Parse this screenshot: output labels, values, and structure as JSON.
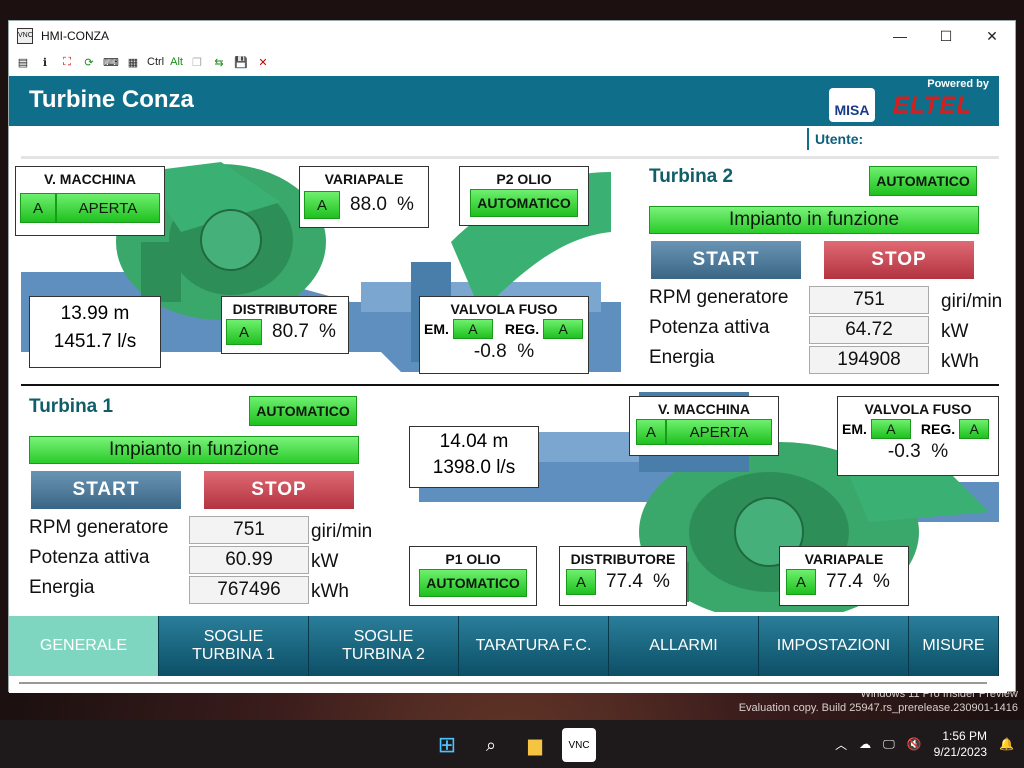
{
  "window": {
    "title": "HMI-CONZA",
    "app_icon": "VNC",
    "controls": [
      "—",
      "☐",
      "✕"
    ]
  },
  "toolbar": {
    "ctrl_label": "Ctrl",
    "alt_label": "Alt"
  },
  "header": {
    "title": "Turbine Conza",
    "powered_by": "Powered by",
    "logo_misa": "MISA",
    "logo_eltel": "ELTEL",
    "user_label": "Utente:"
  },
  "t2": {
    "v_macchina": {
      "title": "V. MACCHINA",
      "mode": "A",
      "state": "APERTA"
    },
    "variapale": {
      "title": "VARIAPALE",
      "mode": "A",
      "value": "88.0",
      "unit": "%"
    },
    "olio": {
      "title": "P2 OLIO",
      "state": "AUTOMATICO"
    },
    "level": {
      "head": "13.99",
      "head_unit": "m",
      "flow": "1451.7",
      "flow_unit": "l/s"
    },
    "distributore": {
      "title": "DISTRIBUTORE",
      "mode": "A",
      "value": "80.7",
      "unit": "%"
    },
    "valvola": {
      "title": "VALVOLA FUSO",
      "em_label": "EM.",
      "em_mode": "A",
      "reg_label": "REG.",
      "reg_mode": "A",
      "value": "-0.8",
      "unit": "%"
    },
    "panel": {
      "title": "Turbina 2",
      "automatico": "AUTOMATICO",
      "status": "Impianto in funzione",
      "start": "START",
      "stop": "STOP",
      "rows": [
        {
          "label": "RPM generatore",
          "value": "751",
          "unit": "giri/min"
        },
        {
          "label": "Potenza attiva",
          "value": "64.72",
          "unit": "kW"
        },
        {
          "label": "Energia",
          "value": "194908",
          "unit": "kWh"
        }
      ]
    }
  },
  "t1": {
    "panel": {
      "title": "Turbina 1",
      "automatico": "AUTOMATICO",
      "status": "Impianto in funzione",
      "start": "START",
      "stop": "STOP",
      "rows": [
        {
          "label": "RPM generatore",
          "value": "751",
          "unit": "giri/min"
        },
        {
          "label": "Potenza attiva",
          "value": "60.99",
          "unit": "kW"
        },
        {
          "label": "Energia",
          "value": "767496",
          "unit": "kWh"
        }
      ]
    },
    "level": {
      "head": "14.04",
      "head_unit": "m",
      "flow": "1398.0",
      "flow_unit": "l/s"
    },
    "v_macchina": {
      "title": "V. MACCHINA",
      "mode": "A",
      "state": "APERTA"
    },
    "valvola": {
      "title": "VALVOLA FUSO",
      "em_label": "EM.",
      "em_mode": "A",
      "reg_label": "REG.",
      "reg_mode": "A",
      "value": "-0.3",
      "unit": "%"
    },
    "olio": {
      "title": "P1 OLIO",
      "state": "AUTOMATICO"
    },
    "distributore": {
      "title": "DISTRIBUTORE",
      "mode": "A",
      "value": "77.4",
      "unit": "%"
    },
    "variapale": {
      "title": "VARIAPALE",
      "mode": "A",
      "value": "77.4",
      "unit": "%"
    }
  },
  "nav": [
    {
      "label": "GENERALE",
      "active": true
    },
    {
      "label": "SOGLIE\nTURBINA 1"
    },
    {
      "label": "SOGLIE\nTURBINA 2"
    },
    {
      "label": "TARATURA F.C."
    },
    {
      "label": "ALLARMI"
    },
    {
      "label": "IMPOSTAZIONI"
    },
    {
      "label": "MISURE"
    }
  ],
  "desktop": {
    "watermark_line1": "Windows 11 Pro Insider Preview",
    "watermark_line2": "Evaluation copy. Build 25947.rs_prerelease.230901-1416"
  },
  "taskbar": {
    "time": "1:56 PM",
    "date": "9/21/2023"
  },
  "colors": {
    "header": "#0f6e8a",
    "green": "#1fc01f",
    "start": "#4a7696",
    "stop": "#c03e4a",
    "nav": "#0c4f66",
    "nav_active": "#7ed6c0"
  }
}
